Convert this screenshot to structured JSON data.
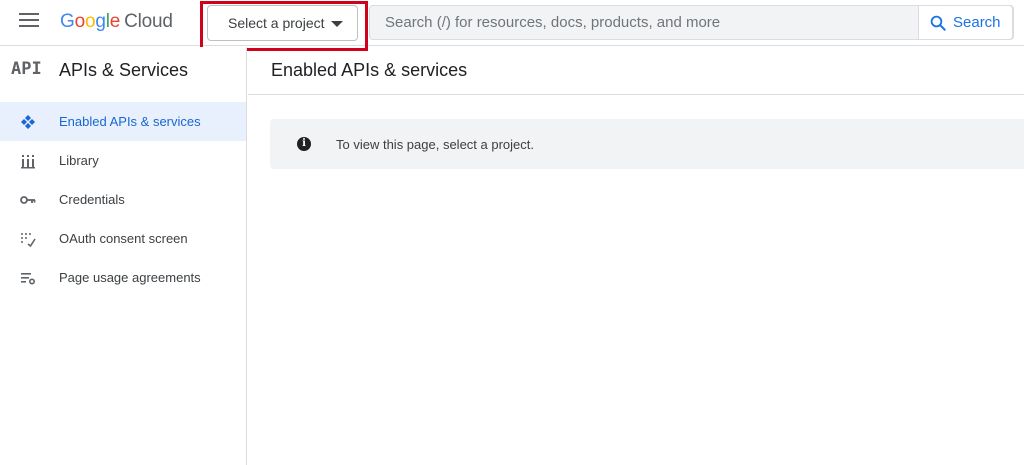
{
  "header": {
    "logo_google": "Google",
    "logo_cloud": "Cloud",
    "project_selector": "Select a project",
    "search": {
      "placeholder": "Search (/) for resources, docs, products, and more",
      "button_label": "Search"
    }
  },
  "sidebar": {
    "glyph": "API",
    "title": "APIs & Services",
    "items": [
      {
        "label": "Enabled APIs & services",
        "icon": "diamond-dots-icon",
        "active": true
      },
      {
        "label": "Library",
        "icon": "library-icon",
        "active": false
      },
      {
        "label": "Credentials",
        "icon": "key-icon",
        "active": false
      },
      {
        "label": "OAuth consent screen",
        "icon": "consent-icon",
        "active": false
      },
      {
        "label": "Page usage agreements",
        "icon": "settings-list-icon",
        "active": false
      }
    ]
  },
  "main": {
    "title": "Enabled APIs & services",
    "banner_icon": "i",
    "banner_message": "To view this page, select a project."
  },
  "colors": {
    "accent": "#1a73e8",
    "active_bg": "#e8f0fe",
    "highlight_box": "#d0021b",
    "banner_bg": "#f1f3f4"
  }
}
